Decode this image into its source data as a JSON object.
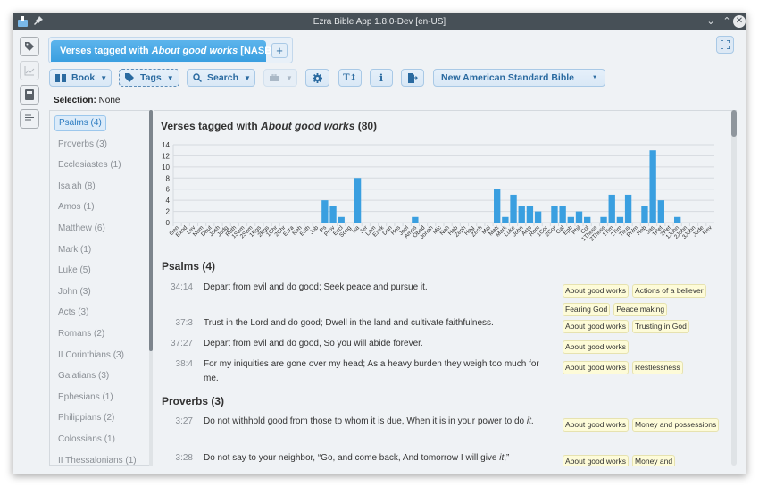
{
  "window": {
    "title": "Ezra Bible App 1.8.0-Dev [en-US]",
    "controls": [
      "minimize",
      "maximize",
      "close"
    ]
  },
  "side_nav": [
    {
      "name": "tags-panel",
      "icon": "tag-icon",
      "enabled": true
    },
    {
      "name": "chart-panel",
      "icon": "chart-icon",
      "enabled": false
    },
    {
      "name": "dictionary-panel",
      "icon": "book-icon",
      "enabled": true
    },
    {
      "name": "outline-panel",
      "icon": "text-align-left-icon",
      "enabled": true
    }
  ],
  "tabs": {
    "active_prefix": "Verses tagged with ",
    "active_tag": "About good works",
    "active_suffix": " [NASB]",
    "add_label": "+"
  },
  "toolbar": {
    "book_label": "Book",
    "tags_label": "Tags",
    "search_label": "Search",
    "translation_label": "New American Standard Bible"
  },
  "selection": {
    "label": "Selection:",
    "value": "None"
  },
  "book_list": [
    "Psalms (4)",
    "Proverbs (3)",
    "Ecclesiastes (1)",
    "Isaiah (8)",
    "Amos (1)",
    "Matthew (6)",
    "Mark (1)",
    "Luke (5)",
    "John (3)",
    "Acts (3)",
    "Romans (2)",
    "II Corinthians (3)",
    "Galatians (3)",
    "Ephesians (1)",
    "Philippians (2)",
    "Colossians (1)",
    "II Thessalonians (1)"
  ],
  "main": {
    "title_prefix": "Verses tagged with ",
    "title_tag": "About good works",
    "title_suffix": " (80)"
  },
  "chart_data": {
    "type": "bar",
    "title": "",
    "xlabel": "",
    "ylabel": "",
    "ylim": [
      0,
      14
    ],
    "yticks": [
      0,
      2,
      4,
      6,
      8,
      10,
      12,
      14
    ],
    "grid": true,
    "color": "#3a9fe0",
    "categories": [
      "Gen",
      "Exod",
      "Lev",
      "Num",
      "Deut",
      "Josh",
      "Judg",
      "Ruth",
      "1Sam",
      "2Sam",
      "1Kgs",
      "2Kgs",
      "1Chr",
      "2Chr",
      "Ezra",
      "Neh",
      "Esth",
      "Job",
      "Ps",
      "Prov",
      "Eccl",
      "Song",
      "Isa",
      "Jer",
      "Lam",
      "Ezek",
      "Dan",
      "Hos",
      "Joel",
      "Amos",
      "Obad",
      "Jonah",
      "Mic",
      "Nah",
      "Hab",
      "Zeph",
      "Hag",
      "Zech",
      "Mal",
      "Matt",
      "Mark",
      "Luke",
      "John",
      "Acts",
      "Rom",
      "1Cor",
      "2Cor",
      "Gal",
      "Eph",
      "Phil",
      "Col",
      "1Thess",
      "2Thess",
      "1Tim",
      "2Tim",
      "Titus",
      "Phlm",
      "Heb",
      "Jas",
      "1Pet",
      "2Pet",
      "1John",
      "2John",
      "3John",
      "Jude",
      "Rev"
    ],
    "values": [
      0,
      0,
      0,
      0,
      0,
      0,
      0,
      0,
      0,
      0,
      0,
      0,
      0,
      0,
      0,
      0,
      0,
      0,
      4,
      3,
      1,
      0,
      8,
      0,
      0,
      0,
      0,
      0,
      0,
      1,
      0,
      0,
      0,
      0,
      0,
      0,
      0,
      0,
      0,
      6,
      1,
      5,
      3,
      3,
      2,
      0,
      3,
      3,
      1,
      2,
      1,
      0,
      1,
      5,
      1,
      5,
      0,
      3,
      13,
      4,
      0,
      1,
      0,
      0,
      0,
      0
    ]
  },
  "sections": [
    {
      "heading": "Psalms (4)",
      "verses": [
        {
          "ref": "34:14",
          "text": "Depart from evil and do good; Seek peace and  pursue it.",
          "tags": [
            "About good works",
            "Actions of a believer",
            "Fearing God",
            "Peace making"
          ]
        },
        {
          "ref": "37:3",
          "text": "Trust in the Lord and do good;  Dwell in the land and  cultivate faithfulness.",
          "tags": [
            "About good works",
            "Trusting in God"
          ]
        },
        {
          "ref": "37:27",
          "text": "Depart from evil and do good,  So you will abide forever.",
          "tags": [
            "About good works"
          ]
        },
        {
          "ref": "38:4",
          "text": "For my iniquities are gone over my head; As a heavy burden they weigh too much for me.",
          "tags": [
            "About good works",
            "Restlessness"
          ]
        }
      ]
    },
    {
      "heading": "Proverbs (3)",
      "verses": [
        {
          "ref": "3:27",
          "text": "Do not withhold good from  those to whom it is due, When it is in your power to do",
          "text_italic": "it",
          "text_end": ".",
          "tags": [
            "About good works",
            "Money and possessions"
          ]
        },
        {
          "ref": "3:28",
          "text": "Do not say to your neighbor, “Go, and come back, And tomorrow I will give",
          "text_italic": "it",
          "text_end": ",”",
          "tags": [
            "About good works",
            "Money and"
          ]
        }
      ]
    }
  ]
}
